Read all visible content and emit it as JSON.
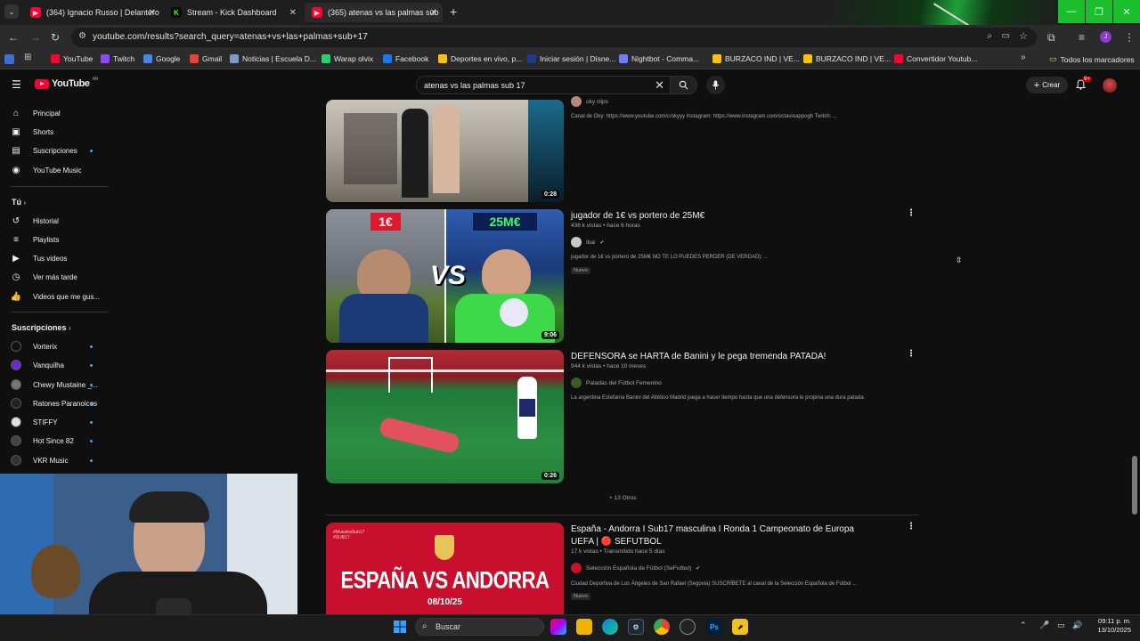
{
  "browser": {
    "tabs": [
      {
        "title": "(364) Ignacio Russo | Delantero",
        "favicon_color": "#ff0033",
        "active": false
      },
      {
        "title": "Stream - Kick Dashboard",
        "favicon_color": "#53fc18",
        "favicon_letter": "K",
        "active": false
      },
      {
        "title": "(365) atenas vs las palmas sub",
        "favicon_color": "#ff0033",
        "active": true
      }
    ],
    "new_tab": "+",
    "url": "youtube.com/results?search_query=atenas+vs+las+palmas+sub+17",
    "bookmarks": [
      {
        "label": "YouTube",
        "color": "#ff0033"
      },
      {
        "label": "Twitch",
        "color": "#9146ff"
      },
      {
        "label": "Google",
        "color": "#4285f4"
      },
      {
        "label": "Gmail",
        "color": "#ea4335"
      },
      {
        "label": "Noticias | Escuela D...",
        "color": "#7a9cc6"
      },
      {
        "label": "Warap olvix",
        "color": "#25d366"
      },
      {
        "label": "Facebook",
        "color": "#1877f2"
      },
      {
        "label": "Deportes en vivo, p...",
        "color": "#ffc107"
      },
      {
        "label": "Iniciar sesión | Disne...",
        "color": "#1e3a8a"
      },
      {
        "label": "Nightbot - Comma...",
        "color": "#6b7cff"
      },
      {
        "label": "BURZACO IND | VE...",
        "color": "#ffc107"
      },
      {
        "label": "BURZACO IND | VE...",
        "color": "#ffc107"
      },
      {
        "label": "Convertidor Youtub...",
        "color": "#ff0033"
      }
    ],
    "bookmarks_overflow": "»",
    "all_bookmarks": "Todos los marcadores"
  },
  "youtube": {
    "logo": "YouTube",
    "logo_region": "AR",
    "search_query": "atenas vs las palmas sub 17",
    "create_label": "Crear",
    "notif_count": "9+",
    "sidebar": {
      "main": [
        {
          "label": "Principal",
          "icon": "home-icon"
        },
        {
          "label": "Shorts",
          "icon": "shorts-icon"
        },
        {
          "label": "Suscripciones",
          "icon": "subscriptions-icon"
        },
        {
          "label": "YouTube Music",
          "icon": "music-icon"
        }
      ],
      "you_heading": "Tú",
      "you": [
        {
          "label": "Historial",
          "icon": "history-icon"
        },
        {
          "label": "Playlists",
          "icon": "playlist-icon"
        },
        {
          "label": "Tus videos",
          "icon": "video-icon"
        },
        {
          "label": "Ver más tarde",
          "icon": "clock-icon"
        },
        {
          "label": "Videos que me gus...",
          "icon": "like-icon"
        }
      ],
      "subs_heading": "Suscripciones",
      "subs": [
        {
          "label": "Vorterix",
          "color": "#111111"
        },
        {
          "label": "Vanquilha",
          "color": "#6a2bd6"
        },
        {
          "label": "Chewy Mustaine _...",
          "color": "#777777"
        },
        {
          "label": "Ratones Paranoicos",
          "color": "#222222"
        },
        {
          "label": "STIFFY",
          "color": "#e0e0e0"
        },
        {
          "label": "Hot Since 82",
          "color": "#444444"
        },
        {
          "label": "VKR Music",
          "color": "#333333"
        }
      ]
    },
    "results": [
      {
        "channel": "oky clips",
        "description": "Canal de Oky: https://www.youtube.com/c/okyyy Instagram: https://www.instagram.com/octavioappogh Twitch: ...",
        "duration": "0:28"
      },
      {
        "title": "jugador de 1€ vs portero de 25M€",
        "meta": "436 k vistas • hace 6 horas",
        "channel": "Ibai",
        "description": "jugador de 1€ vs portero de 25M€ NO TE LO PUEDES PERDER (DE VERDAD): ...",
        "badge": "Nuevo",
        "duration": "9:06",
        "thumb_left_text": "1€",
        "thumb_right_text": "25M€",
        "thumb_vs": "VS"
      },
      {
        "title": "DEFENSORA se HARTA de Banini y le pega tremenda PATADA!",
        "meta": "944 k vistas • hace 10 meses",
        "channel": "Patadas del Fútbol Femenino",
        "description": "La argentina Estefanía Banini del Atlético Madrid juega a hacer tiempo hasta que una defensora le propina una dura patada.",
        "duration": "0:26"
      },
      {
        "title": "España - Andorra I Sub17 masculina I Ronda 1 Campeonato de Europa UEFA | 🔴 SEFUTBOL",
        "meta": "17 k vistas • Transmitido hace 5 días",
        "channel": "Selección Española de Fútbol (SeFutbol)",
        "description": "Ciudad Deportiva de Los Ángeles de San Rafael (Segovia) SUSCRÍBETE al canal de la Selección Española de Fútbol ...",
        "badge": "Nuevo",
        "thumb_tag": "#MuestraSub17 #SUB17",
        "thumb_title": "ESPAÑA VS ANDORRA",
        "thumb_date": "08/10/25"
      }
    ],
    "more_label": "+ 13 Otros"
  },
  "taskbar": {
    "search_label": "Buscar",
    "time": "09:11 p. m.",
    "date": "13/10/2025"
  }
}
